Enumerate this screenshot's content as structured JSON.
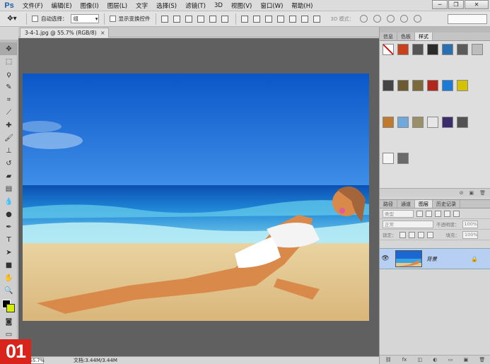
{
  "app": {
    "logo": "Ps"
  },
  "menu": [
    "文件(F)",
    "编辑(E)",
    "图像(I)",
    "图层(L)",
    "文字",
    "选择(S)",
    "滤镜(T)",
    "3D",
    "视图(V)",
    "窗口(W)",
    "帮助(H)"
  ],
  "window_controls": {
    "minimize": "─",
    "restore": "❐",
    "close": "✕"
  },
  "options": {
    "auto_select_label": "自动选择：",
    "auto_select_value": "组",
    "show_transform_label": "显示变换控件",
    "mode_3d_label": "3D 模式："
  },
  "document": {
    "tab_title": "3-4-1.jpg @ 55.7% (RGB/8)",
    "tab_close": "×"
  },
  "status": {
    "zoom": "55.7%",
    "doc_info": "文档:3.44M/3.44M"
  },
  "step_badge": "01",
  "styles_panel": {
    "tabs": [
      "信息",
      "色板",
      "样式"
    ],
    "active_tab": 2,
    "swatch_colors": [
      "#ffffff",
      "#c9411a",
      "#555555",
      "#2b2b2b",
      "#2a6fb0",
      "#5b5b5b",
      "#bdbdbd",
      "#444444",
      "#6b5a32",
      "#7a6a3c",
      "#b3261e",
      "#1c7bd6",
      "#d4c200",
      "",
      "#c07a30",
      "#6fa8dc",
      "#9b8f6a",
      "#e6e6e6",
      "#3b2d6b",
      "#525252",
      "",
      "#f4f4f4",
      "#6a6a6a"
    ]
  },
  "layers_panel": {
    "tabs": [
      "路径",
      "通道",
      "图层",
      "历史记录"
    ],
    "active_tab": 2,
    "kind_label": "类型",
    "blend_mode": "正常",
    "opacity_label": "不透明度：",
    "opacity_value": "100%",
    "lock_label": "锁定：",
    "fill_label": "填充：",
    "fill_value": "100%",
    "layer_name": "背景"
  },
  "colors": {
    "foreground": "#000000",
    "background": "#d7ef00"
  }
}
